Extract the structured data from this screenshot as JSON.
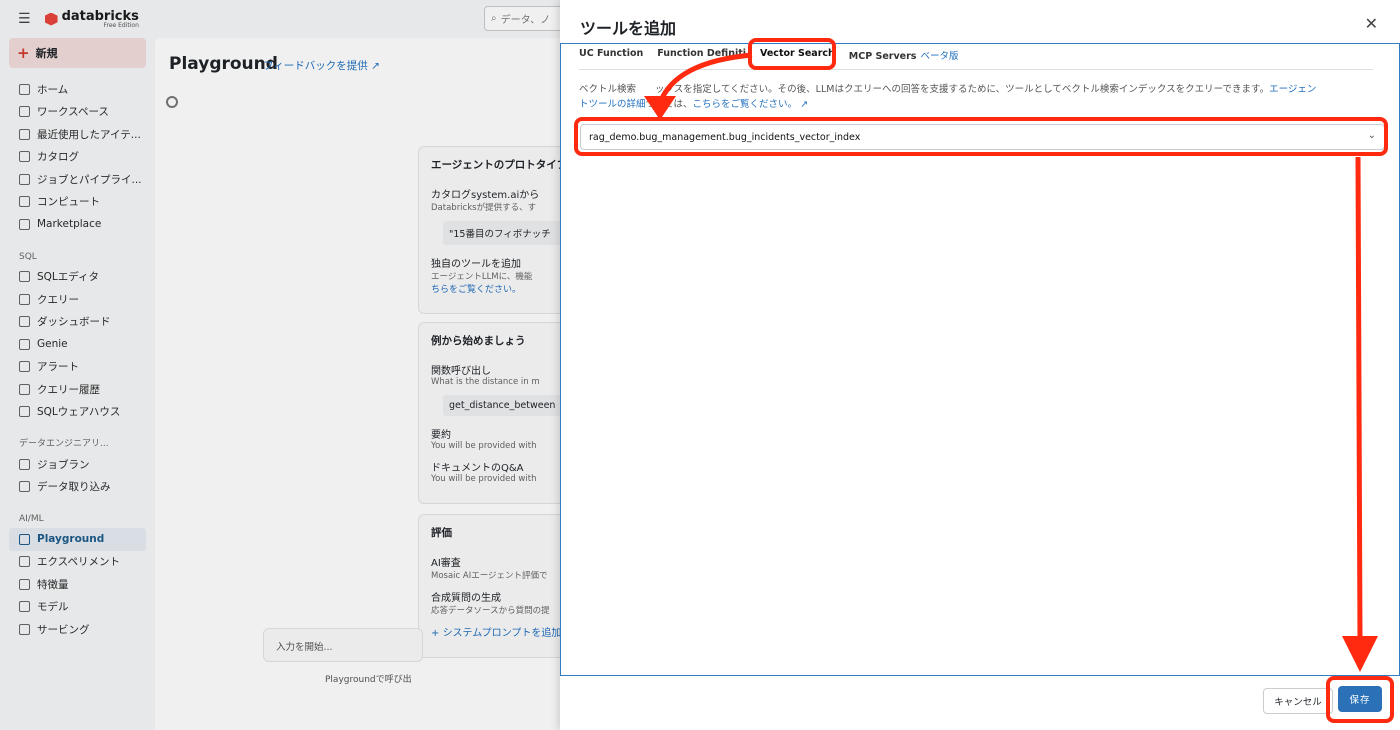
{
  "app": {
    "logo_text": "databricks",
    "edition": "Free Edition",
    "search_placeholder": "データ、ノ"
  },
  "sidebar": {
    "new_label": "新規",
    "items": [
      {
        "label": "ホーム",
        "icon": "home-icon"
      },
      {
        "label": "ワークスペース",
        "icon": "folder-icon"
      },
      {
        "label": "最近使用したアイテ...",
        "icon": "clock-icon"
      },
      {
        "label": "カタログ",
        "icon": "catalog-icon"
      },
      {
        "label": "ジョブとパイプライ...",
        "icon": "workflow-icon"
      },
      {
        "label": "コンピュート",
        "icon": "cloud-icon"
      },
      {
        "label": "Marketplace",
        "icon": "store-icon"
      }
    ],
    "sql_section": "SQL",
    "sql_items": [
      {
        "label": "SQLエディタ",
        "icon": "editor-icon"
      },
      {
        "label": "クエリー",
        "icon": "query-icon"
      },
      {
        "label": "ダッシュボード",
        "icon": "dashboard-icon"
      },
      {
        "label": "Genie",
        "icon": "genie-icon"
      },
      {
        "label": "アラート",
        "icon": "bell-icon"
      },
      {
        "label": "クエリー履歴",
        "icon": "history-icon"
      },
      {
        "label": "SQLウェアハウス",
        "icon": "warehouse-icon"
      }
    ],
    "de_section": "データエンジニアリ...",
    "de_items": [
      {
        "label": "ジョブラン",
        "icon": "list-icon"
      },
      {
        "label": "データ取り込み",
        "icon": "ingest-icon"
      }
    ],
    "ai_section": "AI/ML",
    "ai_items": [
      {
        "label": "Playground",
        "icon": "sparkle-icon",
        "active": true
      },
      {
        "label": "エクスペリメント",
        "icon": "experiment-icon"
      },
      {
        "label": "特徴量",
        "icon": "features-icon"
      },
      {
        "label": "モデル",
        "icon": "model-icon"
      },
      {
        "label": "サービング",
        "icon": "serving-icon"
      }
    ]
  },
  "playground": {
    "title": "Playground",
    "feedback": "フィードバックを提供",
    "card1": {
      "heading": "エージェントのプロトタイプ",
      "row1_title": "カタログsystem.aiから",
      "row1_sub": "Databricksが提供する、す",
      "chip": "\"15番目のフィボナッチ",
      "row2_title": "独自のツールを追加",
      "row2_sub": "エージェントLLMに、機能",
      "row2_link": "ちらをご覧ください。"
    },
    "card2": {
      "heading": "例から始めましょう",
      "r1_title": "関数呼び出し",
      "r1_sub": "What is the distance in m",
      "r1_chip": "get_distance_between",
      "r2_title": "要約",
      "r2_sub": "You will be provided with",
      "r3_title": "ドキュメントのQ&A",
      "r3_sub": "You will be provided with"
    },
    "card3": {
      "heading": "評価",
      "r1_title": "AI審査",
      "r1_sub": "Mosaic AIエージェント評価で",
      "r2_title": "合成質問の生成",
      "r2_sub": "応答データソースから質問の提",
      "add_prompt": "システムプロンプトを追加"
    },
    "input_placeholder": "入力を開始...",
    "footer": "Playgroundで呼び出"
  },
  "dialog": {
    "title": "ツールを追加",
    "tabs": [
      "UC Function",
      "Function Definition",
      "Vector Search",
      "MCP Servers"
    ],
    "tab_visible": [
      "UC Function",
      "Function Definiti",
      "Vector Search",
      "MCP Servers"
    ],
    "active_tab": "Vector Search",
    "beta": "ベータ版",
    "description_a": "ベクトル検索",
    "description_b": "ックスを指定してください。その後、LLMはクエリーへの回答を支援するために、ツールとしてベクトル検索インデックスをクエリーできます。",
    "description_link_a": "エージェン",
    "description_link_b": "トツールの詳細",
    "description_c": "ついては、",
    "description_link_c": "こちらをご覧ください。",
    "selected_index": "rag_demo.bug_management.bug_incidents_vector_index",
    "cancel": "キャンセル",
    "save": "保存"
  },
  "colors": {
    "accent": "#2a71b8",
    "highlight": "#ff2a0f",
    "brand": "#e8453c"
  }
}
